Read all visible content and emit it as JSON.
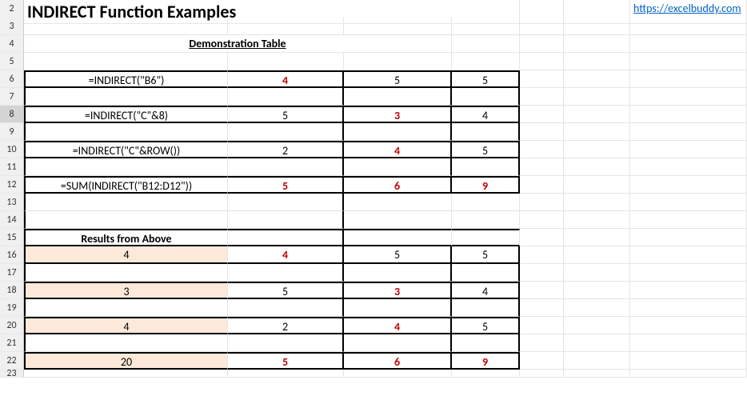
{
  "title": "INDIRECT Function Examples",
  "link": "https://excelbuddy.com",
  "subheader": "Demonstration Table",
  "results_label": "Results from Above",
  "row_headers": [
    "2",
    "3",
    "4",
    "5",
    "6",
    "7",
    "8",
    "9",
    "10",
    "11",
    "12",
    "13",
    "14",
    "15",
    "16",
    "17",
    "18",
    "19",
    "20",
    "21",
    "22",
    "23"
  ],
  "rows": {
    "r6": {
      "A": "=INDIRECT(\"B6\")",
      "B": "4",
      "C": "5",
      "D": "5"
    },
    "r8": {
      "A": "=INDIRECT(\"C\"&8)",
      "B": "5",
      "C": "3",
      "D": "4"
    },
    "r10": {
      "A": "=INDIRECT(\"C\"&ROW())",
      "B": "2",
      "C": "4",
      "D": "5"
    },
    "r12": {
      "A": "=SUM(INDIRECT(\"B12:D12\"))",
      "B": "5",
      "C": "6",
      "D": "9"
    },
    "r16": {
      "A": "4",
      "B": "4",
      "C": "5",
      "D": "5"
    },
    "r18": {
      "A": "3",
      "B": "5",
      "C": "3",
      "D": "4"
    },
    "r20": {
      "A": "4",
      "B": "2",
      "C": "4",
      "D": "5"
    },
    "r22": {
      "A": "20",
      "B": "5",
      "C": "6",
      "D": "9"
    }
  }
}
